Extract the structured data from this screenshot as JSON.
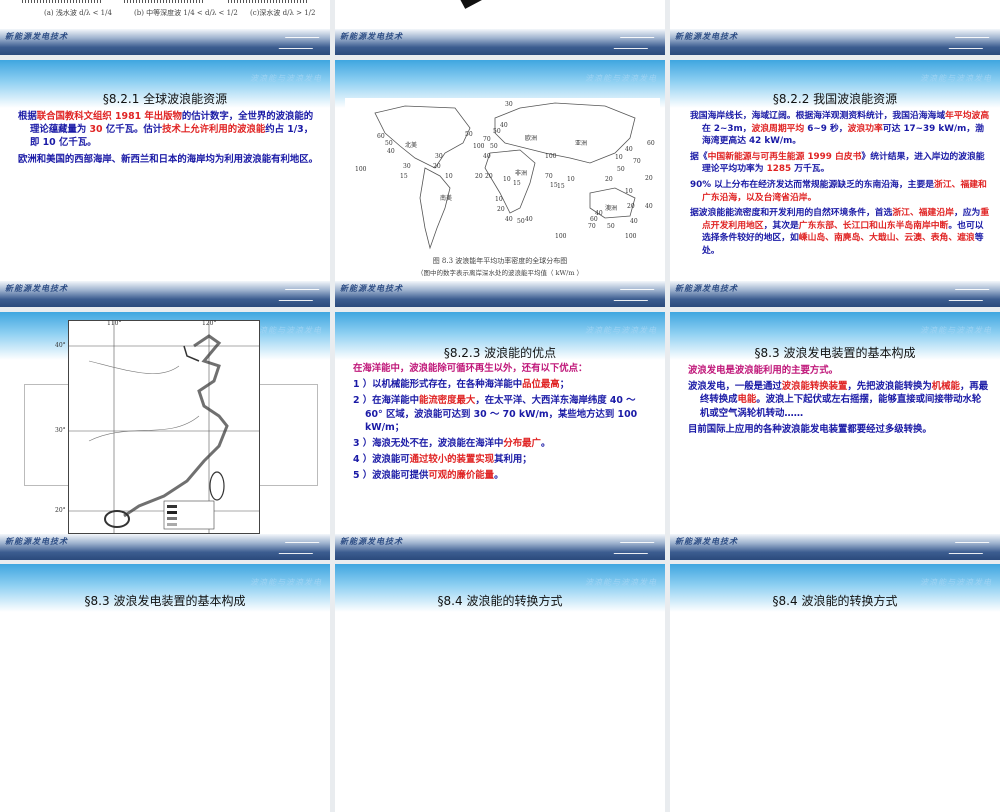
{
  "common": {
    "header_tag": "波浪能与波浪发电",
    "footer_tag": "新能源发电技术"
  },
  "slide1": {
    "formulas": [
      "(a) 浅水波 d/λ < 1/4",
      "(b) 中等深度波 1/4 < d/λ < 1/2",
      "(c)深水波 d/λ > 1/2"
    ]
  },
  "slide4": {
    "title": "§8.2.1  全球波浪能资源",
    "paras": [
      [
        {
          "t": "根据",
          "c": "b"
        },
        {
          "t": "联合国教科文组织  1981  年出版物",
          "c": "r"
        },
        {
          "t": "的估计数字，全世界的波浪能的理论蕴藏量为 ",
          "c": "b"
        },
        {
          "t": "30",
          "c": "r"
        },
        {
          "t": " 亿千瓦。估计",
          "c": "b"
        },
        {
          "t": "技术上允许利用的波浪能",
          "c": "r"
        },
        {
          "t": "约占 1/3，即 10  亿千瓦。",
          "c": "b"
        }
      ],
      [
        {
          "t": "欧洲和美国的西部海岸、新西兰和日本的海岸均为利用波浪能有利地区。",
          "c": "b"
        }
      ]
    ]
  },
  "slide5": {
    "continents": [
      "北美",
      "欧洲",
      "亚洲",
      "非洲",
      "南美",
      "澳洲"
    ],
    "values": [
      "60",
      "50",
      "40",
      "30",
      "100",
      "15",
      "30",
      "20",
      "10",
      "50",
      "70",
      "50",
      "40",
      "100",
      "20",
      "10",
      "15",
      "30",
      "40",
      "50",
      "70",
      "100",
      "20",
      "10",
      "20",
      "40",
      "50",
      "40",
      "15",
      "10",
      "15",
      "60",
      "40",
      "70",
      "10",
      "50",
      "20",
      "10",
      "20",
      "40",
      "60",
      "70",
      "50",
      "100",
      "20",
      "40",
      "40",
      "100"
    ],
    "caption": "图 8.3  波浪能年平均功率密度的全球分布图",
    "caption_note": "（图中的数字表示离岸深水处的波浪能平均值（ kW/m ）"
  },
  "slide6": {
    "title": "§8.2.2  我国波浪能资源",
    "paras": [
      [
        {
          "t": "我国海岸线长，海域辽阔。根据海洋观测资料统计，我国沿海海域",
          "c": "b"
        },
        {
          "t": "年平均波高",
          "c": "r"
        },
        {
          "t": "在 2~3m，",
          "c": "b"
        },
        {
          "t": "波浪周期平均",
          "c": "r"
        },
        {
          "t": " 6~9  秒，",
          "c": "b"
        },
        {
          "t": "波浪功率",
          "c": "r"
        },
        {
          "t": "可达 17~39 kW/m，渤海湾更高达 42 kW/m。",
          "c": "b"
        }
      ],
      [
        {
          "t": "据《",
          "c": "b"
        },
        {
          "t": "中国新能源与可再生能源  1999  白皮书",
          "c": "r"
        },
        {
          "t": "》统计结果，进入岸边的波浪能理论平均功率为 ",
          "c": "b"
        },
        {
          "t": "1285",
          "c": "r"
        },
        {
          "t": "  万千瓦。",
          "c": "b"
        }
      ],
      [
        {
          "t": "90% 以上分布在经济发达而常规能源缺乏的东南沿海，主要是",
          "c": "b"
        },
        {
          "t": "浙江、福建和广东沿海，以及台湾省沿岸。",
          "c": "r"
        }
      ],
      [
        {
          "t": "据波浪能能流密度和开发利用的自然环境条件，首选",
          "c": "b"
        },
        {
          "t": "浙江、福建沿岸",
          "c": "r"
        },
        {
          "t": "，应为",
          "c": "b"
        },
        {
          "t": "重点开发利用地区",
          "c": "r"
        },
        {
          "t": "，其次是",
          "c": "b"
        },
        {
          "t": "广东东部、长江口和山东半岛南岸中断",
          "c": "r"
        },
        {
          "t": "。也可以选择条件较好的地区，如",
          "c": "b"
        },
        {
          "t": "嵊山岛、南麂岛、大戢山、云澳、表角、遮浪",
          "c": "r"
        },
        {
          "t": "等处。",
          "c": "b"
        }
      ]
    ]
  },
  "slide7": {
    "lat_labels": [
      "40°",
      "30°",
      "20°"
    ],
    "lon_labels": [
      "110°",
      "120°"
    ]
  },
  "slide8": {
    "title": "§8.2.3   波浪能的优点",
    "paras": [
      [
        {
          "t": "在海洋能中，波浪能除可循环再生以外，还有以下优点：",
          "c": "m"
        }
      ],
      [
        {
          "t": "1 ）以机械能形式存在，在各种海洋能中",
          "c": "b"
        },
        {
          "t": "品位最高",
          "c": "r"
        },
        {
          "t": "；",
          "c": "b"
        }
      ],
      [
        {
          "t": "2 ）在海洋能中",
          "c": "b"
        },
        {
          "t": "能流密度最大",
          "c": "r"
        },
        {
          "t": "，在太平洋、大西洋东海岸纬度 40 ～ 60° 区域，波浪能可达到 30 ～ 70 kW/m，某些地方达到 100 kW/m；",
          "c": "b"
        }
      ],
      [
        {
          "t": "3 ）海浪无处不在，波浪能在海洋中",
          "c": "b"
        },
        {
          "t": "分布最广",
          "c": "r"
        },
        {
          "t": "。",
          "c": "b"
        }
      ],
      [
        {
          "t": "4 ）波浪能可",
          "c": "b"
        },
        {
          "t": "通过较小的装置实现",
          "c": "r"
        },
        {
          "t": "其利用；",
          "c": "b"
        }
      ],
      [
        {
          "t": "5 ）波浪能可提供",
          "c": "b"
        },
        {
          "t": "可观的廉价能量",
          "c": "r"
        },
        {
          "t": "。",
          "c": "b"
        }
      ]
    ]
  },
  "slide9": {
    "title": "§8.3   波浪发电装置的基本构成",
    "paras": [
      [
        {
          "t": "波浪发电是波浪能利用的主要方式。",
          "c": "m"
        }
      ],
      [
        {
          "t": "波浪发电，一般是通过",
          "c": "b"
        },
        {
          "t": "波浪能转换装置",
          "c": "r"
        },
        {
          "t": "，先把波浪能转换为",
          "c": "b"
        },
        {
          "t": "机械能",
          "c": "r"
        },
        {
          "t": "，再最终转换成",
          "c": "b"
        },
        {
          "t": "电能",
          "c": "r"
        },
        {
          "t": "。波浪上下起伏或左右摇摆，能够直接或间接带动水轮机或空气涡轮机转动……",
          "c": "b"
        }
      ],
      [
        {
          "t": "目前国际上应用的各种波浪能发电装置都要经过多级转换。",
          "c": "b"
        }
      ]
    ]
  },
  "row4_titles": [
    "§8.3  波浪发电装置的基本构成",
    "§8.4  波浪能的转换方式",
    "§8.4  波浪能的转换方式"
  ]
}
